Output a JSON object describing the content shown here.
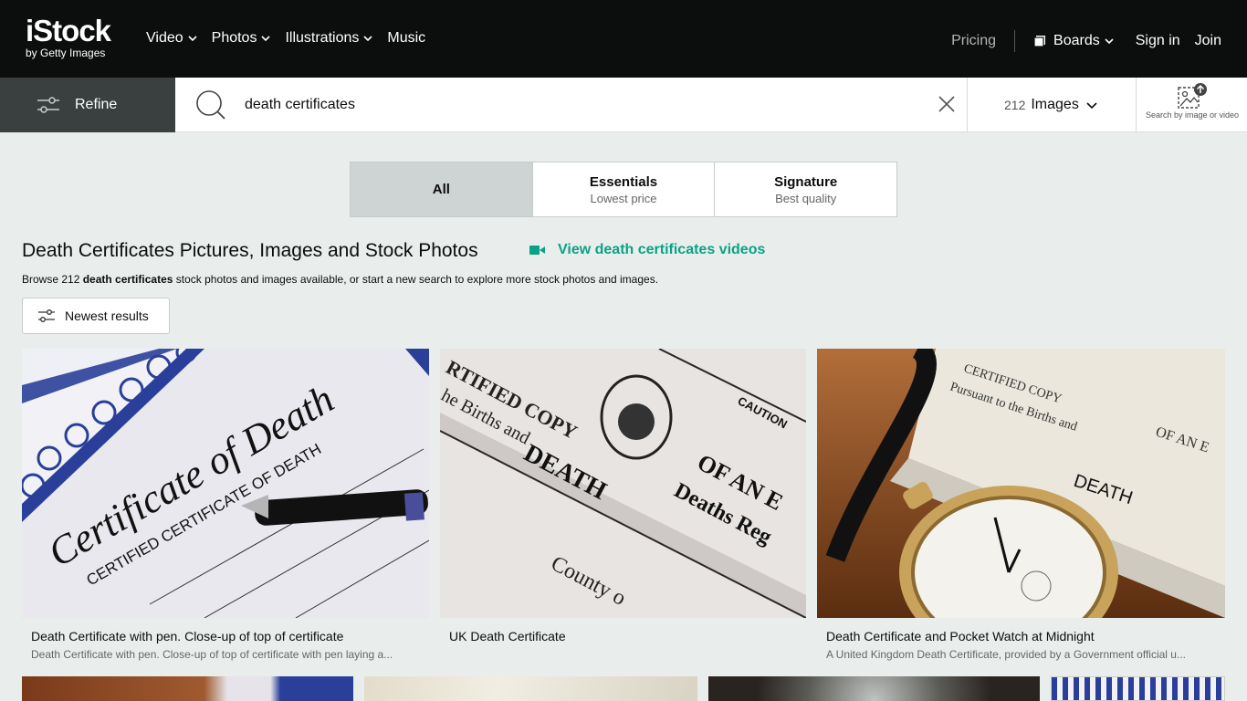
{
  "header": {
    "logo_main": "iStock",
    "logo_sub": "by Getty Images",
    "nav": [
      {
        "label": "Video",
        "has_dropdown": true
      },
      {
        "label": "Photos",
        "has_dropdown": true
      },
      {
        "label": "Illustrations",
        "has_dropdown": true
      },
      {
        "label": "Music",
        "has_dropdown": false
      }
    ],
    "pricing": "Pricing",
    "boards": "Boards",
    "sign_in": "Sign in",
    "join": "Join"
  },
  "search": {
    "refine_label": "Refine",
    "query": "death certificates",
    "result_count": "212",
    "media_type": "Images",
    "image_search_label": "Search by image or video"
  },
  "tabs": [
    {
      "label": "All",
      "sub": "",
      "active": true
    },
    {
      "label": "Essentials",
      "sub": "Lowest price",
      "active": false
    },
    {
      "label": "Signature",
      "sub": "Best quality",
      "active": false
    }
  ],
  "results": {
    "title": "Death Certificates Pictures, Images and Stock Photos",
    "video_link": "View death certificates videos",
    "browse_prefix": "Browse 212 ",
    "browse_term": "death certificates",
    "browse_suffix": " stock photos and images available, or start a new search to explore more stock photos and images.",
    "sort_label": "Newest results"
  },
  "images": [
    {
      "title": "Death Certificate with pen. Close-up of top of certificate",
      "description": "Death Certificate with pen. Close-up of top of certificate with pen laying a...",
      "overlay_text": [
        "Certificate of Death",
        "CERTIFIED CERTIFICATE OF DEATH"
      ]
    },
    {
      "title": "UK Death Certificate",
      "description": "",
      "overlay_text": [
        "CERTIFIED COPY",
        "DEATH",
        "OF AN ENTRY",
        "Deaths Register"
      ]
    },
    {
      "title": "Death Certificate and Pocket Watch at Midnight",
      "description": "A United Kingdom Death Certificate, provided by a Government official u...",
      "overlay_text": [
        "CERTIFIED COPY",
        "DEATH",
        "OF AN ENTRY"
      ]
    }
  ],
  "colors": {
    "accent": "#08a386",
    "header_bg": "#0c0d0d",
    "page_bg": "#e9eeed"
  }
}
